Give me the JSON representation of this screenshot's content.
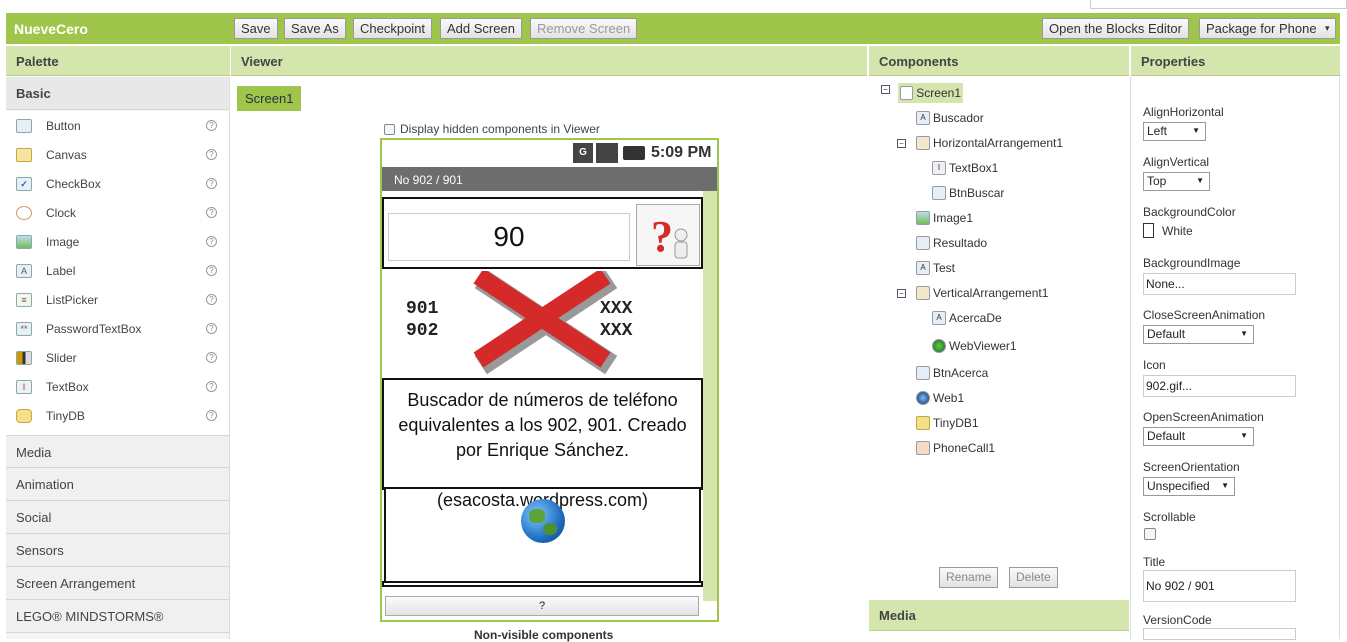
{
  "app_name": "NueveCero",
  "toolbar": {
    "save": "Save",
    "save_as": "Save As",
    "checkpoint": "Checkpoint",
    "add_screen": "Add Screen",
    "remove_screen": "Remove Screen",
    "open_blocks": "Open the Blocks Editor",
    "package": "Package for Phone",
    "package_arrow": "▾"
  },
  "panels": {
    "palette": "Palette",
    "viewer": "Viewer",
    "components": "Components",
    "properties": "Properties",
    "media": "Media"
  },
  "palette": {
    "basic_label": "Basic",
    "items": [
      {
        "label": "Button",
        "icon": "button-icon"
      },
      {
        "label": "Canvas",
        "icon": "canvas-icon"
      },
      {
        "label": "CheckBox",
        "icon": "checkbox-icon"
      },
      {
        "label": "Clock",
        "icon": "clock-icon"
      },
      {
        "label": "Image",
        "icon": "image-icon"
      },
      {
        "label": "Label",
        "icon": "label-icon"
      },
      {
        "label": "ListPicker",
        "icon": "listpicker-icon"
      },
      {
        "label": "PasswordTextBox",
        "icon": "passwordtextbox-icon"
      },
      {
        "label": "Slider",
        "icon": "slider-icon"
      },
      {
        "label": "TextBox",
        "icon": "textbox-icon"
      },
      {
        "label": "TinyDB",
        "icon": "tinydb-icon"
      }
    ],
    "help_glyph": "?",
    "categories": [
      "Media",
      "Animation",
      "Social",
      "Sensors",
      "Screen Arrangement",
      "LEGO® MINDSTORMS®"
    ]
  },
  "viewer": {
    "screen_tab": "Screen1",
    "display_hidden": "Display hidden components in Viewer",
    "status_time": "5:09 PM",
    "status_icon_g": "G",
    "phone_title": "No 902 / 901",
    "textbox_value": "90",
    "image_text_1": "901",
    "image_text_2": "902",
    "image_text_xxx": "XXX",
    "label_text": "Buscador de números de teléfono equivalentes a los 902, 901. Creado por Enrique Sánchez.",
    "label_text_2": "(esacosta.wordpress.com)",
    "bottom_button": "?",
    "non_visible": "Non-visible components"
  },
  "components": {
    "tree": [
      {
        "label": "Screen1",
        "icon": "screen-icon"
      },
      {
        "label": "Buscador",
        "icon": "label-icon"
      },
      {
        "label": "HorizontalArrangement1",
        "icon": "horizontal-arrangement-icon"
      },
      {
        "label": "TextBox1",
        "icon": "textbox-icon"
      },
      {
        "label": "BtnBuscar",
        "icon": "button-icon"
      },
      {
        "label": "Image1",
        "icon": "image-icon"
      },
      {
        "label": "Resultado",
        "icon": "button-icon"
      },
      {
        "label": "Test",
        "icon": "label-icon"
      },
      {
        "label": "VerticalArrangement1",
        "icon": "vertical-arrangement-icon"
      },
      {
        "label": "AcercaDe",
        "icon": "label-icon"
      },
      {
        "label": "WebViewer1",
        "icon": "webviewer-icon"
      },
      {
        "label": "BtnAcerca",
        "icon": "button-icon"
      },
      {
        "label": "Web1",
        "icon": "web-icon"
      },
      {
        "label": "TinyDB1",
        "icon": "tinydb-icon"
      },
      {
        "label": "PhoneCall1",
        "icon": "phonecall-icon"
      }
    ],
    "collapse_glyph": "⊖",
    "rename": "Rename",
    "delete": "Delete"
  },
  "properties": {
    "align_horizontal_label": "AlignHorizontal",
    "align_horizontal_value": "Left",
    "align_vertical_label": "AlignVertical",
    "align_vertical_value": "Top",
    "background_color_label": "BackgroundColor",
    "background_color_value": "White",
    "background_image_label": "BackgroundImage",
    "background_image_value": "None...",
    "close_anim_label": "CloseScreenAnimation",
    "close_anim_value": "Default",
    "icon_label": "Icon",
    "icon_value": "902.gif...",
    "open_anim_label": "OpenScreenAnimation",
    "open_anim_value": "Default",
    "orientation_label": "ScreenOrientation",
    "orientation_value": "Unspecified",
    "scrollable_label": "Scrollable",
    "title_label": "Title",
    "title_value": "No 902 / 901",
    "version_code_label": "VersionCode",
    "dropdown_arrow": "▼"
  },
  "colors": {
    "accent": "#9fc64a",
    "panel_header": "#d4e5ad",
    "phone_title_bar": "#6d6d6d",
    "cross_red": "#d42a2a"
  }
}
